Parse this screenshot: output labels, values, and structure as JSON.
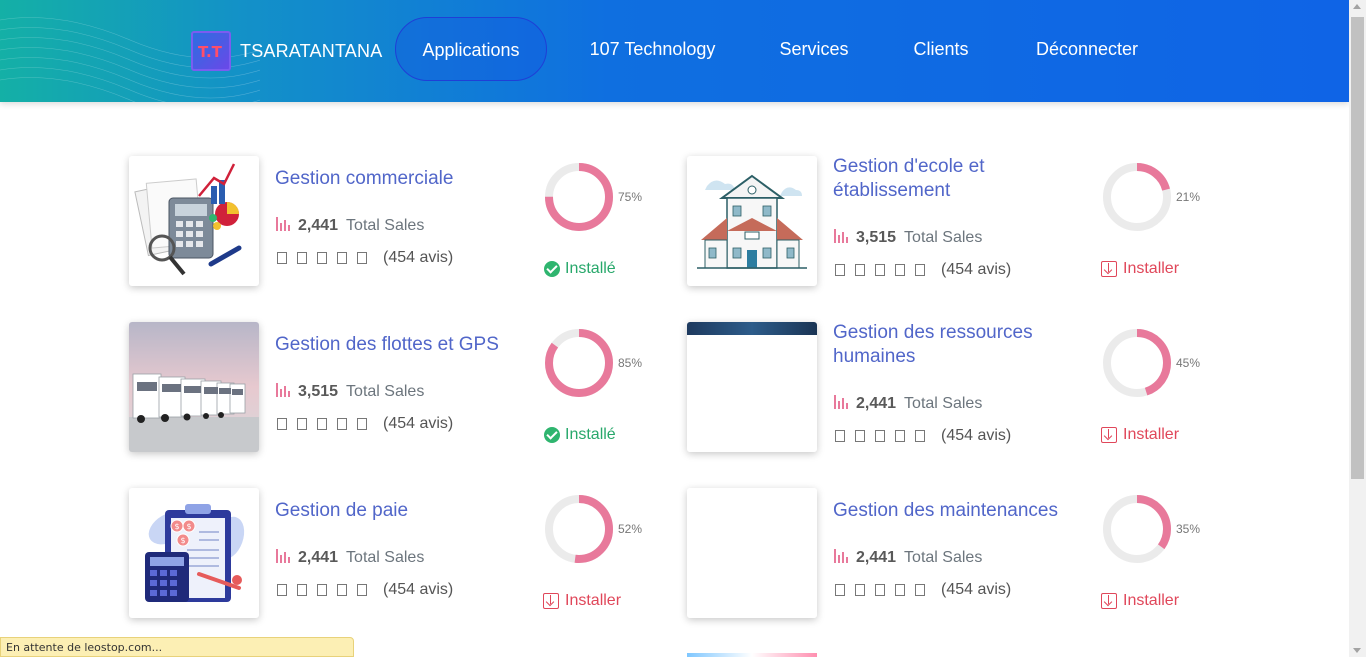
{
  "nav": {
    "brand_logo_text": "T.T",
    "brand": "TSARATANTANA",
    "items": [
      "Applications",
      "107 Technology",
      "Services",
      "Clients",
      "Déconnecter"
    ]
  },
  "colors": {
    "accent": "#5166c9",
    "donut": "#e8799b",
    "installed": "#28a86b",
    "install": "#e0475a"
  },
  "apps": [
    {
      "title": "Gestion commerciale",
      "sales": "2,441",
      "sales_label": "Total Sales",
      "reviews": "(454 avis)",
      "percent": 75,
      "percent_label": "75%",
      "status": "Installé",
      "installed": true,
      "image": "calculator-icon"
    },
    {
      "title": "Gestion d'ecole et établissement",
      "sales": "3,515",
      "sales_label": "Total Sales",
      "reviews": "(454 avis)",
      "percent": 21,
      "percent_label": "21%",
      "status": "Installer",
      "installed": false,
      "image": "school-icon"
    },
    {
      "title": "Gestion des flottes et GPS",
      "sales": "3,515",
      "sales_label": "Total Sales",
      "reviews": "(454 avis)",
      "percent": 85,
      "percent_label": "85%",
      "status": "Installé",
      "installed": true,
      "image": "trucks-photo"
    },
    {
      "title": "Gestion des ressources humaines",
      "sales": "2,441",
      "sales_label": "Total Sales",
      "reviews": "(454 avis)",
      "percent": 45,
      "percent_label": "45%",
      "status": "Installer",
      "installed": false,
      "image": "hr-image"
    },
    {
      "title": "Gestion de paie",
      "sales": "2,441",
      "sales_label": "Total Sales",
      "reviews": "(454 avis)",
      "percent": 52,
      "percent_label": "52%",
      "status": "Installer",
      "installed": false,
      "image": "payroll-icon"
    },
    {
      "title": "Gestion des maintenances",
      "sales": "2,441",
      "sales_label": "Total Sales",
      "reviews": "(454 avis)",
      "percent": 35,
      "percent_label": "35%",
      "status": "Installer",
      "installed": false,
      "image": "blank-image"
    }
  ],
  "statusbar": "En attente de leostop.com..."
}
